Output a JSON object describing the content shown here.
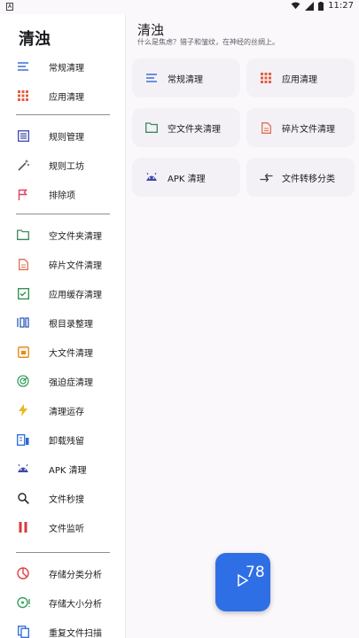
{
  "status_bar": {
    "time": "11:27",
    "left_icon": "A"
  },
  "drawer": {
    "title": "清浊",
    "items": [
      {
        "label": "常规清理",
        "icon": "lines-icon",
        "color": "#3f6fd8"
      },
      {
        "label": "应用清理",
        "icon": "grid-icon",
        "color": "#e06040"
      },
      {
        "label": "规则管理",
        "icon": "list-icon",
        "color": "#3a4aa8"
      },
      {
        "label": "规则工坊",
        "icon": "wand-icon",
        "color": "#555"
      },
      {
        "label": "排除项",
        "icon": "flag-icon",
        "color": "#e04060"
      },
      {
        "label": "空文件夹清理",
        "icon": "folder-icon",
        "color": "#3a8a5a"
      },
      {
        "label": "碎片文件清理",
        "icon": "file-icon",
        "color": "#e07050"
      },
      {
        "label": "应用缓存清理",
        "icon": "check-box-icon",
        "color": "#2a8a4a"
      },
      {
        "label": "根目录整理",
        "icon": "columns-icon",
        "color": "#2a5ab8"
      },
      {
        "label": "大文件清理",
        "icon": "box-icon",
        "color": "#e08a20"
      },
      {
        "label": "强迫症清理",
        "icon": "radar-icon",
        "color": "#3aa060"
      },
      {
        "label": "清理运存",
        "icon": "bolt-icon",
        "color": "#e8b820"
      },
      {
        "label": "卸载残留",
        "icon": "uninstall-icon",
        "color": "#2a6ad8"
      },
      {
        "label": "APK 清理",
        "icon": "android-icon",
        "color": "#3a4aa8"
      },
      {
        "label": "文件秒搜",
        "icon": "search-icon",
        "color": "#222"
      },
      {
        "label": "文件监听",
        "icon": "pause-icon",
        "color": "#d83a3a"
      },
      {
        "label": "存储分类分析",
        "icon": "pie-icon",
        "color": "#e04040"
      },
      {
        "label": "存储大小分析",
        "icon": "size-icon",
        "color": "#3aa060"
      },
      {
        "label": "重复文件扫描",
        "icon": "copy-icon",
        "color": "#2a6ad8"
      }
    ]
  },
  "main": {
    "title": "清浊",
    "subtitle": "什么是焦虑？猎子和皱纹，在神经的丝绸上。",
    "cards": [
      {
        "label": "常规清理",
        "icon": "lines-icon",
        "color": "#3f6fd8"
      },
      {
        "label": "应用清理",
        "icon": "grid-icon",
        "color": "#e06040"
      },
      {
        "label": "空文件夹清理",
        "icon": "folder-icon",
        "color": "#3a8a5a"
      },
      {
        "label": "碎片文件清理",
        "icon": "file-icon",
        "color": "#e07050"
      },
      {
        "label": "APK 清理",
        "icon": "android-icon",
        "color": "#3a4aa8"
      },
      {
        "label": "文件转移分类",
        "icon": "transfer-icon",
        "color": "#444"
      }
    ]
  },
  "floating_widget": {
    "value": "78"
  }
}
